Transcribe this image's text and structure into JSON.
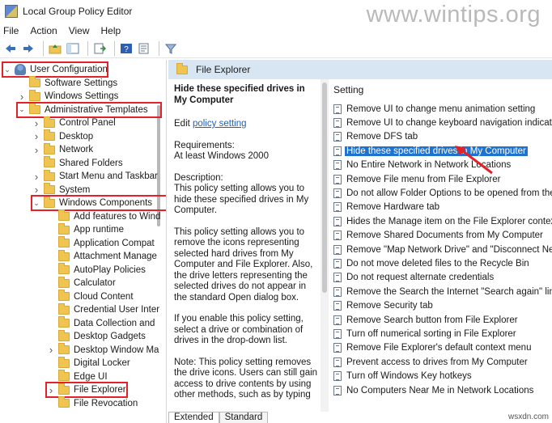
{
  "window": {
    "title": "Local Group Policy Editor",
    "watermark": "www.wintips.org"
  },
  "menu": [
    "File",
    "Action",
    "View",
    "Help"
  ],
  "tree": [
    {
      "label": "User Configuration",
      "chevron": "down",
      "icon": "user-icon",
      "highlighted": true
    },
    {
      "label": "Software Settings",
      "chevron": "",
      "icon": "folder-icon"
    },
    {
      "label": "Windows Settings",
      "chevron": ">",
      "icon": "folder-icon"
    },
    {
      "label": "Administrative Templates",
      "chevron": "down",
      "icon": "folder-icon",
      "highlighted": true
    },
    {
      "label": "Control Panel",
      "chevron": ">",
      "icon": "folder-icon"
    },
    {
      "label": "Desktop",
      "chevron": ">",
      "icon": "folder-icon"
    },
    {
      "label": "Network",
      "chevron": ">",
      "icon": "folder-icon"
    },
    {
      "label": "Shared Folders",
      "chevron": "",
      "icon": "folder-icon"
    },
    {
      "label": "Start Menu and Taskbar",
      "chevron": ">",
      "icon": "folder-icon"
    },
    {
      "label": "System",
      "chevron": ">",
      "icon": "folder-icon"
    },
    {
      "label": "Windows Components",
      "chevron": "down",
      "icon": "folder-icon",
      "highlighted": true
    },
    {
      "label": "Add features to Wind",
      "chevron": "",
      "icon": "folder-icon"
    },
    {
      "label": "App runtime",
      "chevron": "",
      "icon": "folder-icon"
    },
    {
      "label": "Application Compat",
      "chevron": "",
      "icon": "folder-icon"
    },
    {
      "label": "Attachment Manage",
      "chevron": "",
      "icon": "folder-icon"
    },
    {
      "label": "AutoPlay Policies",
      "chevron": "",
      "icon": "folder-icon"
    },
    {
      "label": "Calculator",
      "chevron": "",
      "icon": "folder-icon"
    },
    {
      "label": "Cloud Content",
      "chevron": "",
      "icon": "folder-icon"
    },
    {
      "label": "Credential User Inter",
      "chevron": "",
      "icon": "folder-icon"
    },
    {
      "label": "Data Collection and",
      "chevron": "",
      "icon": "folder-icon"
    },
    {
      "label": "Desktop Gadgets",
      "chevron": "",
      "icon": "folder-icon"
    },
    {
      "label": "Desktop Window Ma",
      "chevron": ">",
      "icon": "folder-icon"
    },
    {
      "label": "Digital Locker",
      "chevron": "",
      "icon": "folder-icon"
    },
    {
      "label": "Edge UI",
      "chevron": "",
      "icon": "folder-icon"
    },
    {
      "label": "File Explorer",
      "chevron": ">",
      "icon": "folder-icon",
      "highlighted": true
    },
    {
      "label": "File Revocation",
      "chevron": "",
      "icon": "folder-icon"
    }
  ],
  "pane": {
    "header": "File Explorer",
    "description": {
      "title": "Hide these specified drives in My Computer",
      "edit_prefix": "Edit ",
      "edit_link": "policy setting",
      "requirements": "Requirements:\nAt least Windows 2000",
      "paragraphs": [
        "Description:\nThis policy setting allows you to hide these specified drives in My Computer.",
        "This policy setting allows you to remove the icons representing selected hard drives from My Computer and File Explorer. Also, the drive letters representing the selected drives do not appear in the standard Open dialog box.",
        "If you enable this policy setting, select a drive or combination of drives in the drop-down list.",
        "Note: This policy setting removes the drive icons. Users can still gain access to drive contents by using other methods, such as by typing"
      ]
    },
    "list_header": "Setting",
    "settings": [
      "Remove UI to change menu animation setting",
      "Remove UI to change keyboard navigation indicator",
      "Remove DFS tab",
      "Hide these specified drives in My Computer",
      "No Entire Network in Network Locations",
      "Remove File menu from File Explorer",
      "Do not allow Folder Options to be opened from the",
      "Remove Hardware tab",
      "Hides the Manage item on the File Explorer context",
      "Remove Shared Documents from My Computer",
      "Remove \"Map Network Drive\" and \"Disconnect Ne",
      "Do not move deleted files to the Recycle Bin",
      "Do not request alternate credentials",
      "Remove the Search the Internet \"Search again\" link",
      "Remove Security tab",
      "Remove Search button from File Explorer",
      "Turn off numerical sorting in File Explorer",
      "Remove File Explorer's default context menu",
      "Prevent access to drives from My Computer",
      "Turn off Windows Key hotkeys",
      "No Computers Near Me in Network Locations"
    ],
    "selected_index": 3
  },
  "tabs": [
    "Extended",
    "Standard"
  ],
  "colors": {
    "highlight_box": "#e4202a",
    "selected_row": "#1e73d1",
    "pane_header": "#d8e6f3"
  },
  "corner_mark": "wsxdn.com"
}
